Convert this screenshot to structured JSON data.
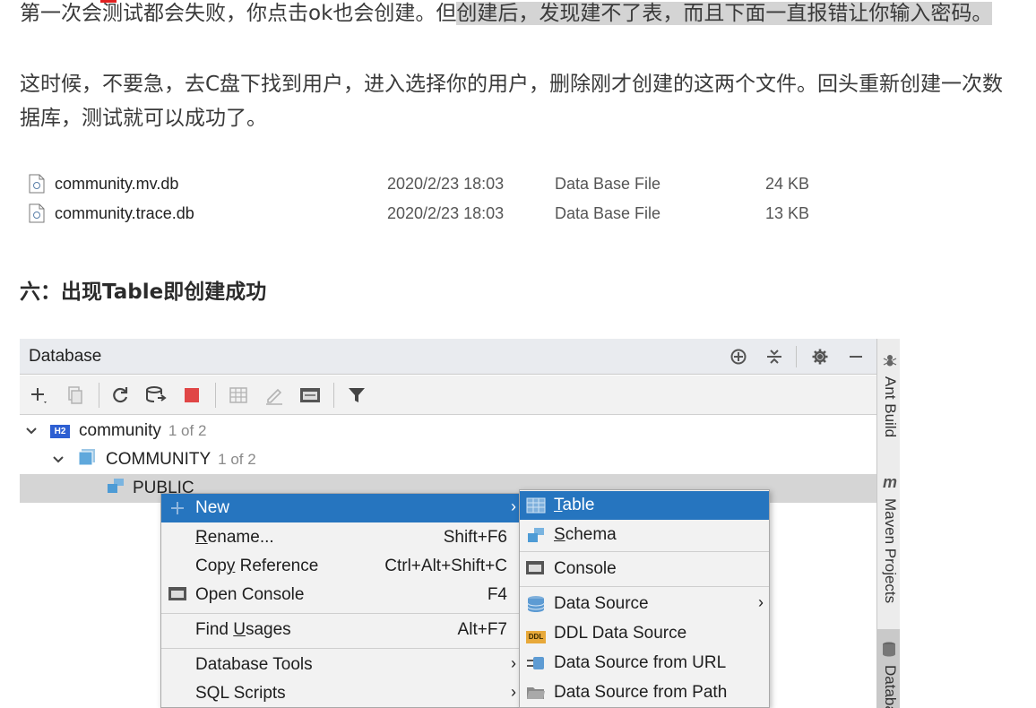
{
  "article": {
    "para1_plain": "第一次会测试都会失败，你点击ok也会创建。但",
    "para1_highlight": "创建后，发现建不了表，而且下面一直报错让你输入密码。",
    "para2": "这时候，不要急，去C盘下找到用户，进入选择你的用户，删除刚才创建的这两个文件。回头重新创建一次数据库，测试就可以成功了。",
    "heading": "六：出现Table即创建成功"
  },
  "files": [
    {
      "name": "community.mv.db",
      "date": "2020/2/23 18:03",
      "type": "Data Base File",
      "size": "24 KB"
    },
    {
      "name": "community.trace.db",
      "date": "2020/2/23 18:03",
      "type": "Data Base File",
      "size": "13 KB"
    }
  ],
  "ide": {
    "panel_title": "Database",
    "tree": {
      "root_label": "community",
      "root_badge": "H2",
      "root_count": "1 of 2",
      "schema_label": "COMMUNITY",
      "schema_count": "1 of 2",
      "selected_label": "PUBLIC"
    },
    "context_menu": {
      "new": "New",
      "rename_pre": "",
      "rename_u": "R",
      "rename_post": "ename...",
      "rename_shortcut": "Shift+F6",
      "copyref_pre": "Cop",
      "copyref_u": "y",
      "copyref_post": " Reference",
      "copyref_shortcut": "Ctrl+Alt+Shift+C",
      "openconsole": "Open Console",
      "openconsole_shortcut": "F4",
      "findusages_pre": "Find ",
      "findusages_u": "U",
      "findusages_post": "sages",
      "findusages_shortcut": "Alt+F7",
      "dbtools": "Database Tools",
      "sqlscripts": "SQL Scripts"
    },
    "submenu": {
      "table_u": "T",
      "table_post": "able",
      "schema_u": "S",
      "schema_post": "chema",
      "console": "Console",
      "datasource": "Data Source",
      "ddl": "DDL Data Source",
      "ddl_badge": "DDL",
      "url": "Data Source from URL",
      "path": "Data Source from Path"
    },
    "side_strip": {
      "ant": "Ant Build",
      "maven": "Maven Projects",
      "maven_glyph": "m",
      "database": "Database"
    },
    "colors": {
      "selection": "#2675bf",
      "stop": "#e04646"
    }
  }
}
